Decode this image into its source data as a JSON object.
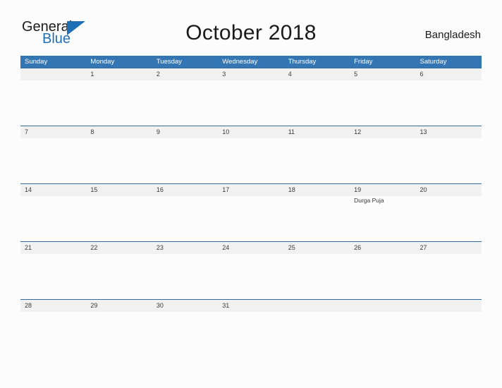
{
  "brand": {
    "word_one": "General",
    "word_two": "Blue",
    "accent_color": "#1f6fb5"
  },
  "header": {
    "title": "October 2018",
    "country": "Bangladesh"
  },
  "calendar": {
    "header_bg": "#3475b3",
    "date_band_bg": "#f1f1f1",
    "separator_color": "#2e6da4",
    "weekdays": [
      "Sunday",
      "Monday",
      "Tuesday",
      "Wednesday",
      "Thursday",
      "Friday",
      "Saturday"
    ],
    "weeks": [
      [
        {
          "date": "",
          "event": ""
        },
        {
          "date": "1",
          "event": ""
        },
        {
          "date": "2",
          "event": ""
        },
        {
          "date": "3",
          "event": ""
        },
        {
          "date": "4",
          "event": ""
        },
        {
          "date": "5",
          "event": ""
        },
        {
          "date": "6",
          "event": ""
        }
      ],
      [
        {
          "date": "7",
          "event": ""
        },
        {
          "date": "8",
          "event": ""
        },
        {
          "date": "9",
          "event": ""
        },
        {
          "date": "10",
          "event": ""
        },
        {
          "date": "11",
          "event": ""
        },
        {
          "date": "12",
          "event": ""
        },
        {
          "date": "13",
          "event": ""
        }
      ],
      [
        {
          "date": "14",
          "event": ""
        },
        {
          "date": "15",
          "event": ""
        },
        {
          "date": "16",
          "event": ""
        },
        {
          "date": "17",
          "event": ""
        },
        {
          "date": "18",
          "event": ""
        },
        {
          "date": "19",
          "event": "Durga Puja"
        },
        {
          "date": "20",
          "event": ""
        }
      ],
      [
        {
          "date": "21",
          "event": ""
        },
        {
          "date": "22",
          "event": ""
        },
        {
          "date": "23",
          "event": ""
        },
        {
          "date": "24",
          "event": ""
        },
        {
          "date": "25",
          "event": ""
        },
        {
          "date": "26",
          "event": ""
        },
        {
          "date": "27",
          "event": ""
        }
      ],
      [
        {
          "date": "28",
          "event": ""
        },
        {
          "date": "29",
          "event": ""
        },
        {
          "date": "30",
          "event": ""
        },
        {
          "date": "31",
          "event": ""
        },
        {
          "date": "",
          "event": ""
        },
        {
          "date": "",
          "event": ""
        },
        {
          "date": "",
          "event": ""
        }
      ]
    ]
  }
}
